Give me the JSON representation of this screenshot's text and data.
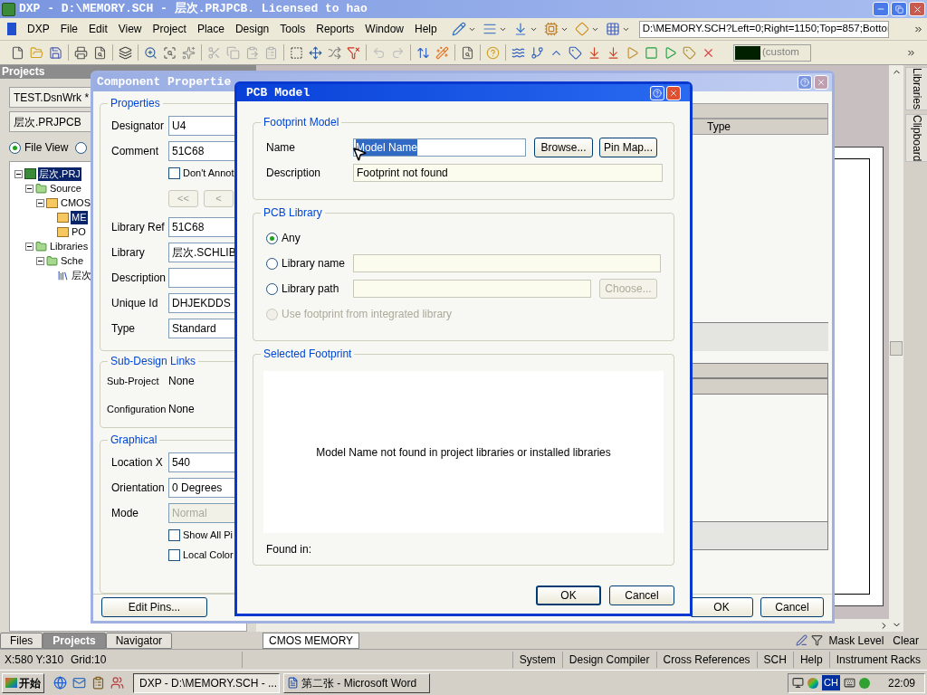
{
  "app_window": {
    "title": "DXP - D:\\MEMORY.SCH - 层次.PRJPCB. Licensed to hao",
    "menu": [
      "DXP",
      "File",
      "Edit",
      "View",
      "Project",
      "Place",
      "Design",
      "Tools",
      "Reports",
      "Window",
      "Help"
    ],
    "address": "D:\\MEMORY.SCH?Left=0;Right=1150;Top=857;Bottoı",
    "color_combo": "(custom"
  },
  "projects_panel": {
    "title": "Projects",
    "workspace": "TEST.DsnWrk *",
    "project": "层次.PRJPCB",
    "views": [
      {
        "label": "File View",
        "selected": true
      },
      {
        "selected": false
      }
    ],
    "tree": [
      {
        "label": "层次.PRJ",
        "kind": "project",
        "selected": true,
        "expanded": true,
        "children": [
          {
            "label": "Source",
            "kind": "folder",
            "selected": false,
            "expanded": true,
            "children": [
              {
                "label": "CMOS",
                "kind": "sheet",
                "selected": false,
                "expanded": true,
                "children": [
                  {
                    "label": "ME",
                    "kind": "sheet",
                    "selected": true
                  },
                  {
                    "label": "PO",
                    "kind": "sheet",
                    "selected": false
                  }
                ]
              }
            ]
          },
          {
            "label": "Libraries",
            "kind": "folder",
            "selected": false,
            "expanded": true,
            "children": [
              {
                "label": "Sche",
                "kind": "folder",
                "selected": false,
                "expanded": true,
                "children": [
                  {
                    "label": "层次",
                    "kind": "library",
                    "selected": false
                  }
                ]
              }
            ]
          }
        ]
      }
    ]
  },
  "side_tabs": [
    "Libraries",
    "Clipboard"
  ],
  "component_dialog": {
    "title": "Component Propertie",
    "properties": {
      "legend": "Properties",
      "rows": [
        {
          "kind": "field",
          "label": "Designator",
          "value": "U4",
          "disabled": false
        },
        {
          "kind": "field",
          "label": "Comment",
          "value": "51C68",
          "disabled": false
        },
        {
          "kind": "checkbox",
          "label": "Don't Annot",
          "checked": false
        },
        {
          "kind": "nav",
          "buttons": [
            "<<",
            "<"
          ],
          "disabled": true
        },
        {
          "kind": "field",
          "label": "Library Ref",
          "value": "51C68",
          "disabled": false
        },
        {
          "kind": "field",
          "label": "Library",
          "value": "层次.SCHLIB",
          "disabled": false
        },
        {
          "kind": "field",
          "label": "Description",
          "disabled": false
        },
        {
          "kind": "field",
          "label": "Unique Id",
          "value": "DHJEKDDS",
          "disabled": false
        },
        {
          "kind": "field",
          "label": "Type",
          "value": "Standard",
          "disabled": false
        }
      ]
    },
    "sub_design_links": {
      "legend": "Sub-Design Links",
      "rows": [
        {
          "label": "Sub-Project",
          "value": "None"
        },
        {
          "label": "Configuration",
          "value": "None"
        }
      ]
    },
    "graphical": {
      "legend": "Graphical",
      "rows": [
        {
          "kind": "field",
          "label": "Location X",
          "value": "540",
          "disabled": false
        },
        {
          "kind": "field",
          "label": "Orientation",
          "value": "0 Degrees",
          "disabled": false
        },
        {
          "kind": "field",
          "label": "Mode",
          "value": "Normal",
          "disabled": true
        },
        {
          "kind": "checkbox",
          "label": "Show All Pi",
          "checked": false
        },
        {
          "kind": "checkbox",
          "label": "Local Color",
          "checked": false
        }
      ]
    },
    "grid_column": "Type",
    "edit_pins": "Edit Pins...",
    "buttons": [
      "OK",
      "Cancel"
    ]
  },
  "pcb_model_dialog": {
    "title": "PCB Model",
    "footprint_model": {
      "legend": "Footprint Model",
      "name_label": "Name",
      "name_value": "Model Name",
      "browse": "Browse...",
      "pin_map": "Pin Map...",
      "description_label": "Description",
      "description_value": "Footprint not found"
    },
    "pcb_library": {
      "legend": "PCB Library",
      "options": [
        {
          "kind": "plain",
          "label": "Any",
          "selected": true,
          "disabled": false
        },
        {
          "kind": "field",
          "label": "Library name",
          "selected": false,
          "disabled": false
        },
        {
          "kind": "browse",
          "label": "Library path",
          "selected": false,
          "disabled": false,
          "button": "Choose..."
        },
        {
          "kind": "plain",
          "label": "Use footprint from integrated library",
          "selected": false,
          "disabled": true
        }
      ]
    },
    "selected_footprint": {
      "legend": "Selected Footprint",
      "message": "Model Name not found in project libraries or installed libraries",
      "found_in": "Found in:"
    },
    "buttons": [
      "OK",
      "Cancel"
    ]
  },
  "panel_tabs": [
    {
      "label": "Files",
      "selected": false
    },
    {
      "label": "Projects",
      "selected": true
    },
    {
      "label": "Navigator",
      "selected": false
    }
  ],
  "document_tabs": [
    {
      "label": "CMOS MEMORY",
      "selected": true
    }
  ],
  "sheet_tools": [
    "Mask Level",
    "Clear"
  ],
  "status_bar": {
    "position": "X:580 Y:310",
    "grid": "Grid:10",
    "panels": [
      "System",
      "Design Compiler",
      "Cross References",
      "SCH",
      "Help",
      "Instrument Racks"
    ]
  },
  "taskbar": {
    "start": "开始",
    "tasks": [
      {
        "label": "DXP - D:\\MEMORY.SCH - ...",
        "kind": "dxp",
        "selected": true
      },
      {
        "label": "第二张 - Microsoft Word",
        "kind": "word",
        "selected": false
      }
    ],
    "language": "CH",
    "clock": "22:09"
  }
}
